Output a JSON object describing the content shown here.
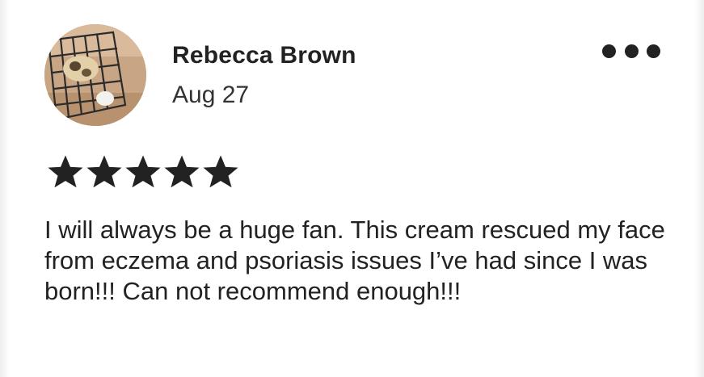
{
  "review": {
    "reviewer_name": "Rebecca Brown",
    "date": "Aug 27",
    "rating": 5,
    "rating_max": 5,
    "text": "I will always be a huge fan. This cream rescued my face from eczema and psoriasis issues I’ve had since I was born!!! Can not recommend enough!!!"
  },
  "icons": {
    "more": "more-options-icon",
    "star": "star-icon"
  },
  "colors": {
    "text": "#222222",
    "star": "#222222",
    "background": "#ffffff"
  }
}
